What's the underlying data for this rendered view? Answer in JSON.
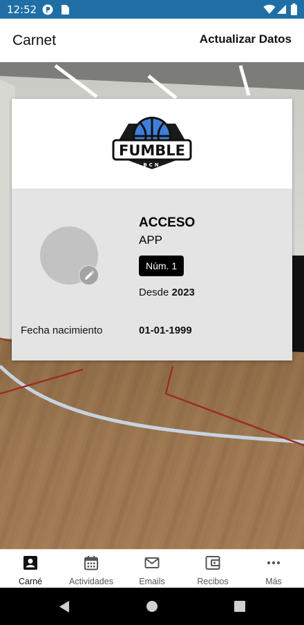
{
  "status_bar": {
    "time": "12:52"
  },
  "app_bar": {
    "title": "Carnet",
    "action_label": "Actualizar Datos"
  },
  "logo": {
    "text": "FUMBLE",
    "subtext": "BCN",
    "accent": "#3f7fd8"
  },
  "member": {
    "title": "ACCESO",
    "subtitle": "APP",
    "number_badge": "Núm. 1",
    "since_prefix": "Desde ",
    "since_year": "2023",
    "dob_label": "Fecha nacimiento",
    "dob_value": "01-01-1999"
  },
  "bottom_nav": [
    {
      "label": "Carné",
      "icon": "id-card-icon",
      "active": true
    },
    {
      "label": "Actividades",
      "icon": "calendar-icon",
      "active": false
    },
    {
      "label": "Emails",
      "icon": "mail-icon",
      "active": false
    },
    {
      "label": "Recibos",
      "icon": "wallet-icon",
      "active": false
    },
    {
      "label": "Más",
      "icon": "more-horizontal-icon",
      "active": false
    }
  ],
  "colors": {
    "status_bar": "#1f6fa6",
    "card_info_bg": "#e4e4e4",
    "badge_bg": "#000000"
  }
}
